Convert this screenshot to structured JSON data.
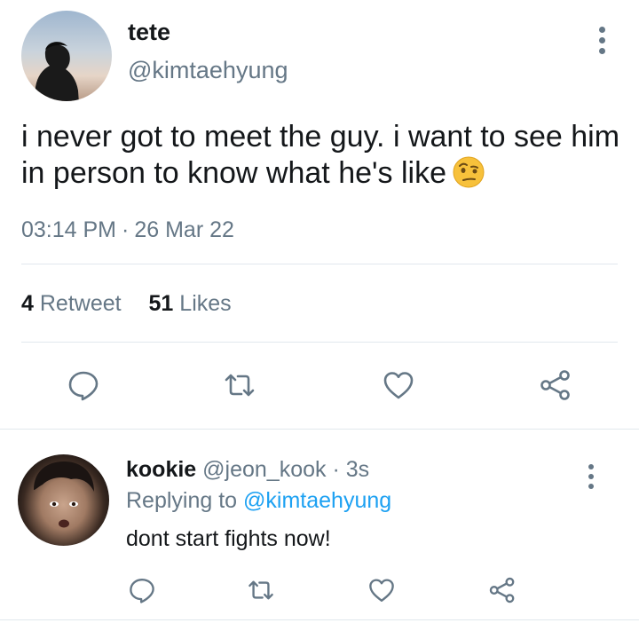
{
  "tweet": {
    "author_name": "tete",
    "author_handle": "@kimtaehyung",
    "text": "i never got to meet the guy. i want to see him in person to know what he's like",
    "emoji": "raised-eyebrow-emoji",
    "time": "03:14 PM",
    "separator": "·",
    "date": "26 Mar 22",
    "retweet_count": "4",
    "retweet_label": "Retweet",
    "like_count": "51",
    "like_label": "Likes"
  },
  "reply": {
    "author_name": "kookie",
    "author_handle": "@jeon_kook",
    "time": "· 3s",
    "replying_label": "Replying to",
    "replying_to": "@kimtaehyung",
    "text": "dont start fights now!"
  },
  "icons": {
    "reply": "speech-bubble-icon",
    "retweet": "retweet-icon",
    "like": "heart-icon",
    "share": "share-icon",
    "more": "more-vertical-icon"
  },
  "colors": {
    "primary_text": "#14171a",
    "secondary_text": "#657786",
    "link": "#1da1f2",
    "divider": "#e1e8ed"
  }
}
